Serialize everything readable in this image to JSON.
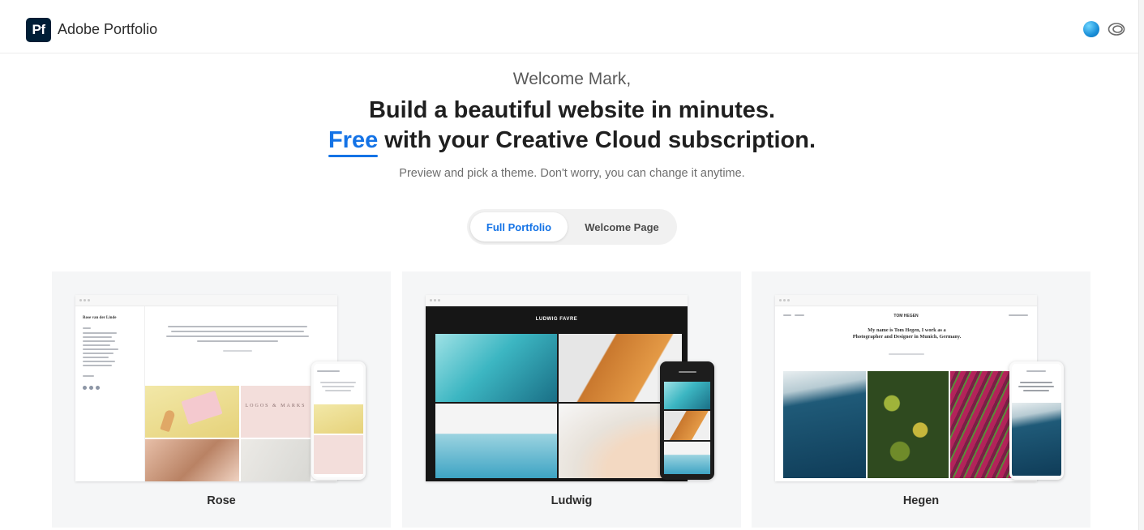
{
  "header": {
    "logo_text": "Pf",
    "app_name": "Adobe Portfolio",
    "avatar_color": "#1a8fd8",
    "icons": [
      "user-avatar",
      "creative-cloud-icon"
    ]
  },
  "hero": {
    "welcome": "Welcome Mark,",
    "headline_line1": "Build a beautiful website in minutes.",
    "headline_free": "Free",
    "headline_rest": " with your Creative Cloud subscription.",
    "subline": "Preview and pick a theme. Don't worry, you can change it anytime.",
    "accent_color": "#1473e6"
  },
  "toggle": {
    "options": [
      "Full Portfolio",
      "Welcome Page"
    ],
    "selected": "Full Portfolio"
  },
  "themes": [
    {
      "name": "Rose",
      "preview": {
        "site_title": "Rose van der Linde",
        "intro": "My name is Rose van der Linde and I'm a passionate graphic designer. Within my designs I value simplicity, symmetry and detail. Whether I'm designing books, branding, packaging or websites I always strive for beauty and balance.",
        "tile_text": "LOGOS & MARKS"
      }
    },
    {
      "name": "Ludwig",
      "preview": {
        "site_title": "LUDWIG FAVRE"
      }
    },
    {
      "name": "Hegen",
      "preview": {
        "site_title": "TOM HEGEN",
        "intro": "My name is Tom Hegen, I work as a Photographer and Designer in Munich, Germany."
      }
    }
  ]
}
